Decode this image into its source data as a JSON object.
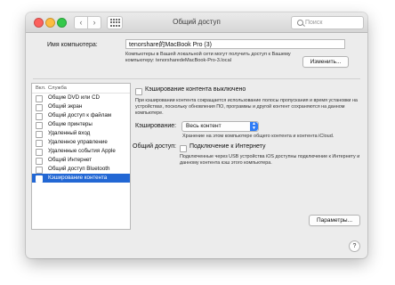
{
  "window": {
    "title": "Общий доступ",
    "search_placeholder": "Поиск"
  },
  "toolbar": {
    "back_icon": "chevron-left-icon",
    "forward_icon": "chevron-right-icon",
    "grid_icon": "grid-icon",
    "back_glyph": "‹",
    "forward_glyph": "›"
  },
  "computer": {
    "label": "Имя компьютера:",
    "name": "tenorshare的MacBook Pro (3)",
    "description": "Компьютеры в Вашей локальной сети могут получить доступ к Вашему компьютеру: tenorsharedeMacBook-Pro-3.local",
    "edit_button": "Изменить..."
  },
  "services": {
    "header_on": "Вкл.",
    "header_service": "Служба",
    "selected_index": 11,
    "items": [
      {
        "label": "Общие DVD или CD"
      },
      {
        "label": "Общий экран"
      },
      {
        "label": "Общий доступ к файлам"
      },
      {
        "label": "Общие принтеры"
      },
      {
        "label": "Удаленный вход"
      },
      {
        "label": "Удаленное управление"
      },
      {
        "label": "Удаленные события Apple"
      },
      {
        "label": "Общий Интернет"
      },
      {
        "label": "Общий доступ Bluetooth"
      },
      {
        "label": "Кэширование контента"
      }
    ]
  },
  "detail": {
    "title": "Кэширование контента выключено",
    "description": "При кэшировании контента сокращается использование полосы пропускания и время установки на устройствах, поскольку обновления ПО, программы и другой контент сохраняются на данном компьютере.",
    "cache_label": "Кэширование:",
    "cache_value": "Весь контент",
    "cache_hint": "Хранение на этом компьютере общего контента и контента iCloud.",
    "share_label": "Общий доступ:",
    "internet_label": "Подключение к Интернету",
    "internet_desc": "Подключенные через USB устройства iOS доступны подключение к Интернету и данному контента кэш этого компьютера.",
    "params_button": "Параметры...",
    "help_glyph": "?"
  },
  "colors": {
    "selection": "#2267d4",
    "window_bg": "#ececec",
    "popup_arrow": "#2f7cf6"
  }
}
